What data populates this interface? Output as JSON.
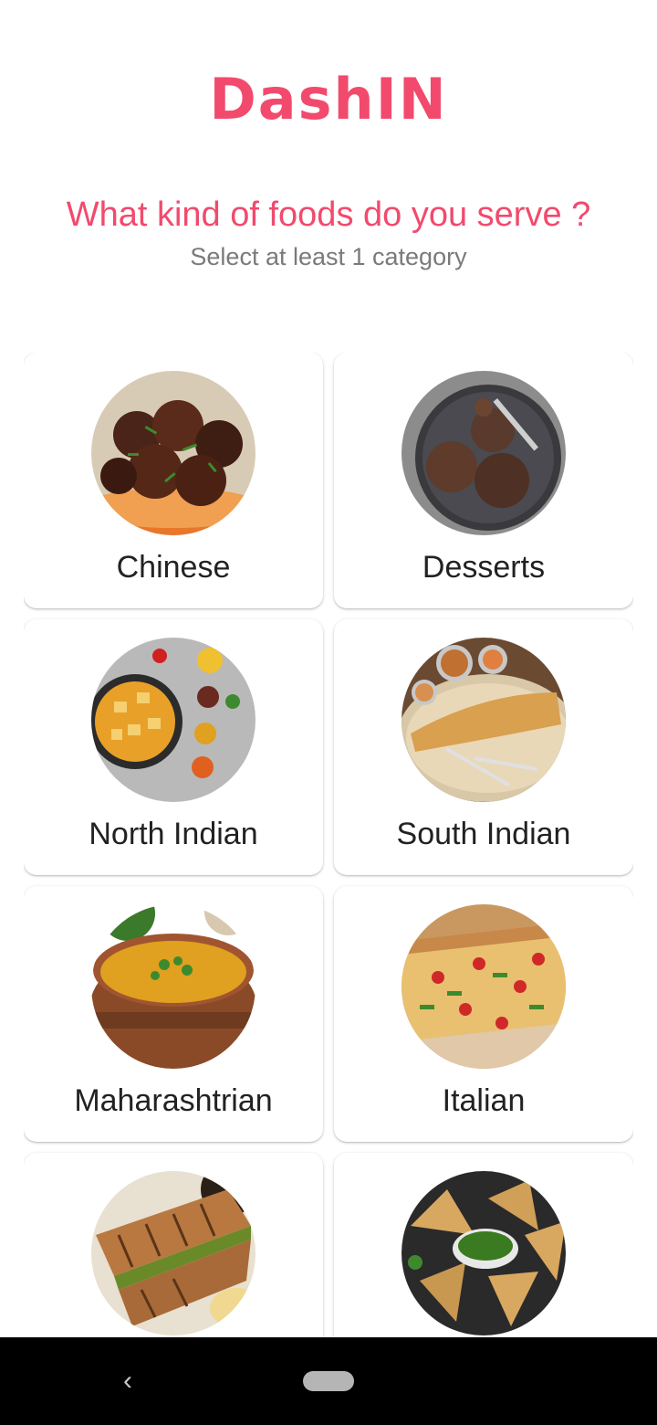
{
  "app": {
    "name": "DashIN",
    "brand_color": "#f24a6d"
  },
  "header": {
    "question": "What kind of foods do you serve ?",
    "subtitle": "Select at least 1 category"
  },
  "categories": [
    {
      "label": "Chinese",
      "image": "chinese-food-image"
    },
    {
      "label": "Desserts",
      "image": "desserts-image"
    },
    {
      "label": "North Indian",
      "image": "north-indian-food-image"
    },
    {
      "label": "South Indian",
      "image": "south-indian-food-image"
    },
    {
      "label": "Maharashtrian",
      "image": "maharashtrian-food-image"
    },
    {
      "label": "Italian",
      "image": "italian-food-image"
    },
    {
      "label": "",
      "image": "sandwich-image"
    },
    {
      "label": "",
      "image": "samosa-image"
    }
  ],
  "navbar": {
    "back_icon": "back-icon",
    "home_icon": "home-pill-icon"
  }
}
